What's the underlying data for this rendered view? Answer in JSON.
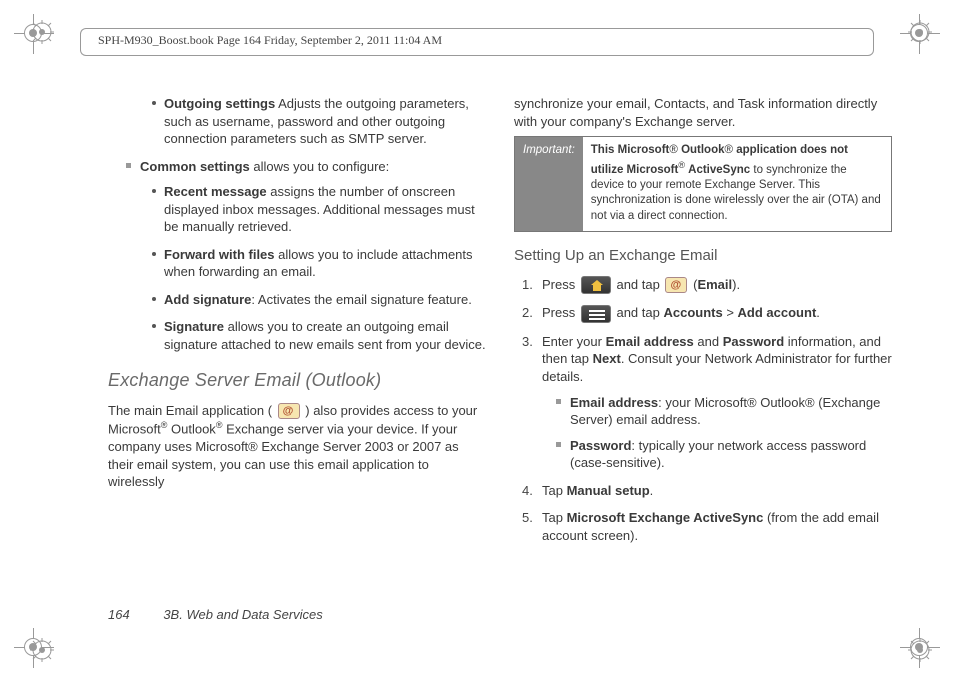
{
  "sym": {
    "reg": "®"
  },
  "header": {
    "text": "SPH-M930_Boost.book  Page 164  Friday, September 2, 2011  11:04 AM"
  },
  "left": {
    "outgoing": {
      "title": "Outgoing settings",
      "body": "Adjusts the outgoing parameters, such as username, password and other outgoing connection parameters such as SMTP server."
    },
    "common": {
      "title": "Common settings",
      "body": "allows you to configure:"
    },
    "items": [
      {
        "title": "Recent message",
        "body": "assigns the number of onscreen displayed inbox messages. Additional messages must be manually retrieved."
      },
      {
        "title": "Forward with files",
        "body": "allows you to include attachments when forwarding an email."
      },
      {
        "title": "Add signature",
        "body": ": Activates the email signature feature."
      },
      {
        "title": "Signature",
        "body": "allows you to create an outgoing email signature attached to new emails sent from your device."
      }
    ],
    "heading": "Exchange Server Email (Outlook)",
    "para": {
      "p1": "The main Email application ( ",
      "p2": " ) also provides access to your Microsoft",
      "p3": " Outlook",
      "p4": " Exchange server via your device. If your company uses Microsoft® Exchange Server 2003 or 2007 as their email system, you can use this email application to wirelessly"
    }
  },
  "right": {
    "intro": "synchronize your email, Contacts, and Task information directly with your company's Exchange server.",
    "note": {
      "label": "Important:",
      "bold1": "This Microsoft",
      "bold2": " Outlook",
      "bold3": " application does not utilize Microsoft",
      "bold4": " ActiveSync",
      "rest": " to synchronize the device to your remote Exchange Server. This synchronization is done wirelessly over the air (OTA) and not via a direct connection."
    },
    "subheading": "Setting Up an Exchange Email",
    "steps": [
      {
        "a": "Press ",
        "b": " and tap ",
        "c": " (",
        "d": "Email",
        "e": ")."
      },
      {
        "a": "Press ",
        "b": " and tap ",
        "c": "Accounts",
        "d": " > ",
        "e": "Add account",
        "f": "."
      },
      {
        "a": "Enter your",
        "b": "Email address",
        "c": "and",
        "d": "Password",
        "e": "information, and then tap",
        "f": "Next",
        "g": ". Consult your Network Administrator for further details."
      },
      {
        "a": "Tap",
        "b": "Manual setup",
        "c": "."
      },
      {
        "a": "Tap",
        "b": "Microsoft Exchange ActiveSync",
        "c": "(from the add email account screen)."
      }
    ],
    "sub": [
      {
        "t": "Email address",
        "b": ": your Microsoft® Outlook® (Exchange Server) email address."
      },
      {
        "t": "Password",
        "b": ": typically your network access password (case-sensitive)."
      }
    ]
  },
  "footer": {
    "page": "164",
    "section": "3B. Web and Data Services"
  }
}
